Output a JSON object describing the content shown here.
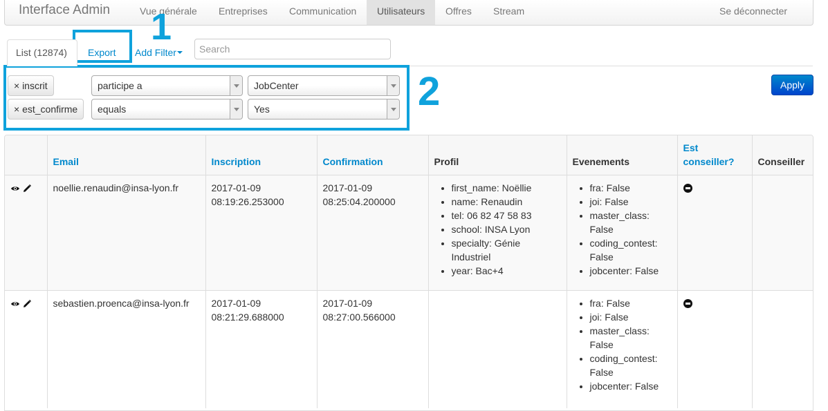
{
  "navbar": {
    "brand": "Interface Admin",
    "items": [
      "Vue générale",
      "Entreprises",
      "Communication",
      "Utilisateurs",
      "Offres",
      "Stream"
    ],
    "logout": "Se déconnecter"
  },
  "tabs": {
    "list_label": "List (12874)",
    "export_label": "Export",
    "add_filter_label": "Add Filter"
  },
  "search": {
    "placeholder": "Search",
    "value": ""
  },
  "filters": [
    {
      "remove_label": "× inscrit",
      "operation": "participe a",
      "value": "JobCenter"
    },
    {
      "remove_label": "× est_confirme",
      "operation": "equals",
      "value": "Yes"
    }
  ],
  "apply_label": "Apply",
  "annotations": {
    "one": "1",
    "two": "2"
  },
  "annotation_color": "#0fa2dc",
  "accent_color": "#0088cc",
  "table": {
    "columns": [
      "",
      "Email",
      "Inscription",
      "Confirmation",
      "Profil",
      "Evenements",
      "Est conseiller?",
      "Conseiller"
    ],
    "rows": [
      {
        "email": "noellie.renaudin@insa-lyon.fr",
        "inscription": [
          "2017-01-09",
          "08:19:26.253000"
        ],
        "confirmation": [
          "2017-01-09",
          "08:25:04.200000"
        ],
        "profil": [
          "first_name: Noëllie",
          "name: Renaudin",
          "tel: 06 82 47 58 83",
          "school: INSA Lyon",
          "specialty: Génie Industriel",
          "year: Bac+4"
        ],
        "evenements": [
          "fra: False",
          "joi: False",
          "master_class: False",
          "coding_contest: False",
          "jobcenter: False"
        ],
        "conseiller": ""
      },
      {
        "email": "sebastien.proenca@insa-lyon.fr",
        "inscription": [
          "2017-01-09",
          "08:21:29.688000"
        ],
        "confirmation": [
          "2017-01-09",
          "08:27:00.566000"
        ],
        "profil": [],
        "evenements": [
          "fra: False",
          "joi: False",
          "master_class: False",
          "coding_contest: False",
          "jobcenter: False"
        ],
        "conseiller": ""
      }
    ]
  }
}
